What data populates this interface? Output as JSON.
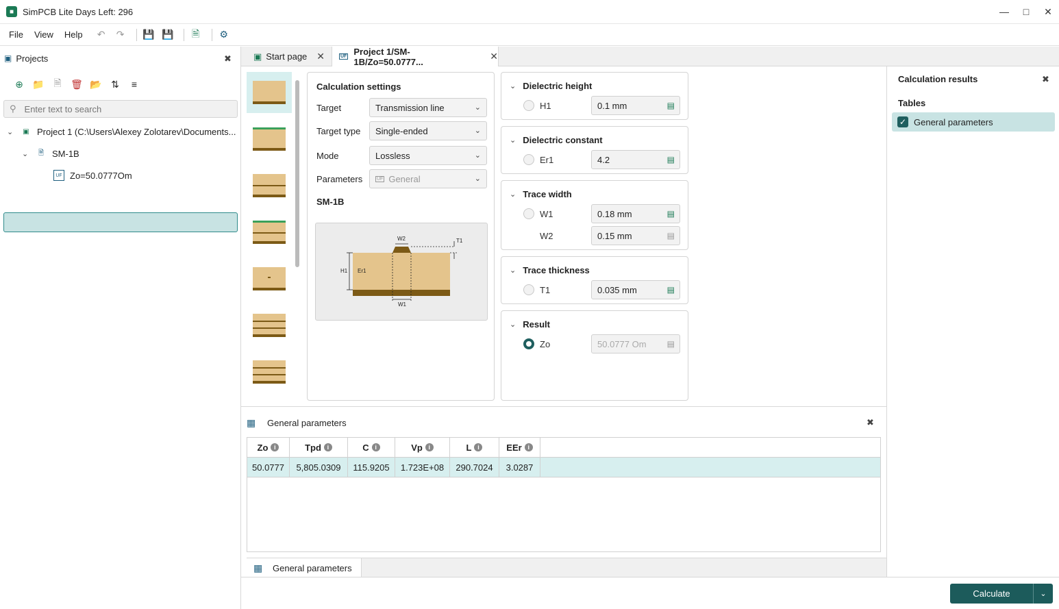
{
  "window": {
    "title": "SimPCB Lite Days Left: 296",
    "app_icon": "pcb-app-icon"
  },
  "menu": {
    "file": "File",
    "view": "View",
    "help": "Help"
  },
  "projects_panel": {
    "title": "Projects",
    "search_placeholder": "Enter text to search",
    "tree": {
      "project": "Project 1 (C:\\Users\\Alexey Zolotarev\\Documents...",
      "structure": "SM-1B",
      "calculation": "Zo=50.0777Om"
    }
  },
  "tabs": {
    "start": "Start page",
    "project": "Project 1/SM-1B/Zo=50.0777..."
  },
  "calc_settings": {
    "title": "Calculation settings",
    "target_label": "Target",
    "target_value": "Transmission line",
    "target_type_label": "Target type",
    "target_type_value": "Single-ended",
    "mode_label": "Mode",
    "mode_value": "Lossless",
    "parameters_label": "Parameters",
    "parameters_value": "General",
    "structure_name": "SM-1B",
    "diagram_labels": {
      "w2": "W2",
      "t1": "T1",
      "h1": "H1",
      "er1": "Er1",
      "w1": "W1"
    }
  },
  "params": {
    "dielectric_height": {
      "title": "Dielectric height",
      "name": "H1",
      "value": "0.1 mm"
    },
    "dielectric_constant": {
      "title": "Dielectric constant",
      "name": "Er1",
      "value": "4.2"
    },
    "trace_width": {
      "title": "Trace width",
      "w1_name": "W1",
      "w1_value": "0.18 mm",
      "w2_name": "W2",
      "w2_value": "0.15 mm"
    },
    "trace_thickness": {
      "title": "Trace thickness",
      "name": "T1",
      "value": "0.035 mm"
    },
    "result": {
      "title": "Result",
      "name": "Zo",
      "value": "50.0777 Om"
    }
  },
  "general_parameters": {
    "title": "General parameters",
    "columns": [
      "Zo",
      "Tpd",
      "C",
      "Vp",
      "L",
      "EEr"
    ],
    "row": [
      "50.0777",
      "5,805.0309",
      "115.9205",
      "1.723E+08",
      "290.7024",
      "3.0287"
    ],
    "tab_label": "General parameters"
  },
  "results_panel": {
    "title": "Calculation results",
    "tables_label": "Tables",
    "item": "General parameters"
  },
  "footer": {
    "calculate_label": "Calculate"
  }
}
